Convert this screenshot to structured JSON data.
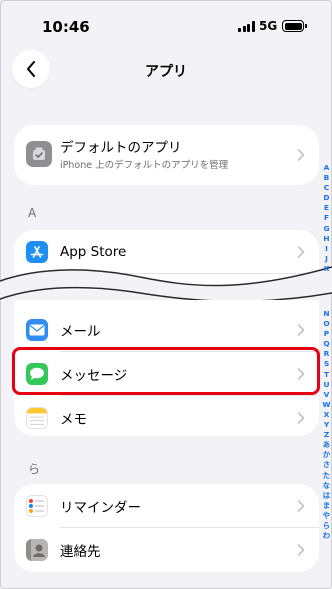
{
  "status_bar": {
    "time": "10:46",
    "network": "5G"
  },
  "nav": {
    "title": "アプリ"
  },
  "default_apps": {
    "title": "デフォルトのアプリ",
    "subtitle": "iPhone 上のデフォルトのアプリを管理"
  },
  "sections": {
    "a": {
      "header": "A",
      "items": [
        {
          "label": "App Store"
        }
      ]
    },
    "ma": {
      "items": [
        {
          "label": "メール"
        },
        {
          "label": "メッセージ"
        },
        {
          "label": "メモ"
        }
      ]
    },
    "ra": {
      "header": "ら",
      "items": [
        {
          "label": "リマインダー"
        },
        {
          "label": "連絡先"
        }
      ]
    }
  },
  "index_top": [
    "A",
    "B",
    "C",
    "D",
    "E",
    "F",
    "G",
    "H",
    "I",
    "J",
    "K"
  ],
  "index_bottom": [
    "N",
    "O",
    "P",
    "Q",
    "R",
    "S",
    "T",
    "U",
    "V",
    "W",
    "X",
    "Y",
    "Z",
    "あ",
    "か",
    "さ",
    "た",
    "な",
    "は",
    "ま",
    "や",
    "ら",
    "わ"
  ],
  "colors": {
    "highlight": "#e60012",
    "appstore": "#1e8ff3",
    "mail": "#2f8df0",
    "messages": "#34c759",
    "notes_top": "#fcc934",
    "background": "#f2f2f7"
  }
}
